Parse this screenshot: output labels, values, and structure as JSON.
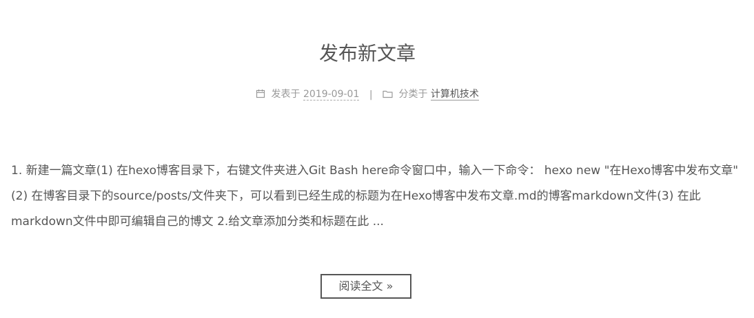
{
  "post": {
    "title": "发布新文章",
    "meta": {
      "posted_label": "发表于",
      "date": "2019-09-01",
      "separator": "|",
      "category_label": "分类于",
      "category": "计算机技术"
    },
    "excerpt": "1. 新建一篇文章(1) 在hexo博客目录下，右键文件夹进入Git Bash here命令窗口中，输入一下命令： hexo new \"在Hexo博客中发布文章\"(2) 在博客目录下的source/posts/文件夹下，可以看到已经生成的标题为在Hexo博客中发布文章.md的博客markdown文件(3) 在此markdown文件中即可编辑自己的博文 2.给文章添加分类和标题在此 ...",
    "read_more_label": "阅读全文 »"
  },
  "icons": {
    "date": "calendar-icon",
    "category": "folder-icon"
  },
  "colors": {
    "text": "#555555",
    "meta": "#999999",
    "background": "#ffffff"
  }
}
